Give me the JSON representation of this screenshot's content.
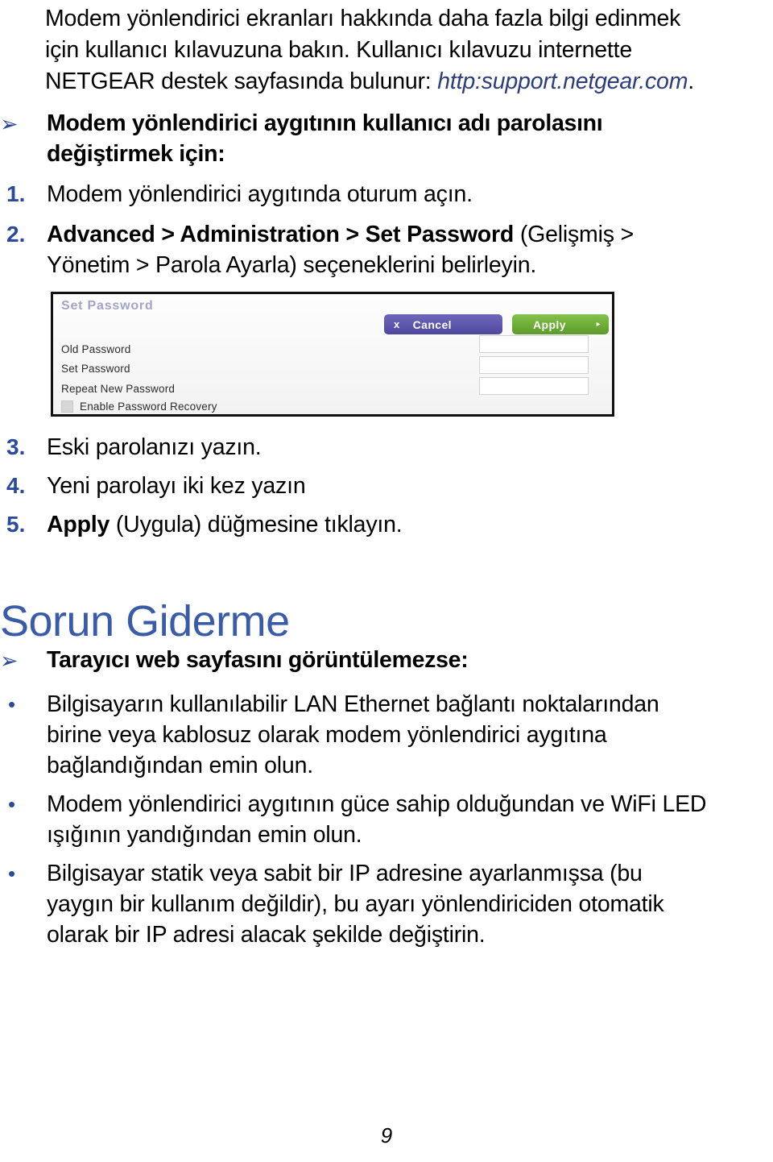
{
  "document": {
    "page_number": "9",
    "language": "tr"
  },
  "intro": {
    "line1": "Modem yönlendirici ekranları hakkında daha fazla bilgi edinmek",
    "line2": "için kullanıcı kılavuzuna bakın. Kullanıcı kılavuzu internette",
    "line3_prefix": "NETGEAR destek sayfasında bulunur: ",
    "link_text": "http:support.netgear.com",
    "line3_suffix": "."
  },
  "procedure": {
    "heading_line1": "Modem yönlendirici aygıtının kullanıcı adı parolasını",
    "heading_line2": "değiştirmek için:",
    "arrow_glyph": "➢",
    "steps": [
      {
        "number": "1.",
        "text": "Modem yönlendirici aygıtında oturum açın."
      },
      {
        "number": "2.",
        "bold_part": "Advanced > Administration > Set Password",
        "rest_line1": " (Gelişmiş >",
        "line2": "Yönetim > Parola Ayarla) seçeneklerini belirleyin."
      },
      {
        "number": "3.",
        "text": "Eski parolanızı yazın."
      },
      {
        "number": "4.",
        "text": "Yeni parolayı iki kez yazın"
      },
      {
        "number": "5.",
        "bold_part": "Apply",
        "rest": " (Uygula) düğmesine tıklayın."
      }
    ]
  },
  "screenshot": {
    "panel_title": "Set Password",
    "labels": [
      "Old Password",
      "Set Password",
      "Repeat New Password"
    ],
    "checkbox_label": "Enable Password Recovery",
    "checkbox_checked": false,
    "fields": [
      {
        "name": "old-password",
        "value": ""
      },
      {
        "name": "set-password",
        "value": ""
      },
      {
        "name": "repeat-new-password",
        "value": ""
      }
    ],
    "cancel_button": {
      "label": "Cancel",
      "icon": "x",
      "color": "#5a52a8"
    },
    "apply_button": {
      "label": "Apply",
      "icon": "▸",
      "color": "#6fae38"
    }
  },
  "troubleshooting": {
    "title": "Sorun Giderme",
    "arrow_glyph": "➢",
    "sub_heading": "Tarayıcı web sayfasını görüntülemezse:",
    "bullet_glyph": "•",
    "bullets": [
      {
        "line1": "Bilgisayarın kullanılabilir LAN Ethernet bağlantı noktalarından",
        "line2": "birine veya kablosuz olarak modem yönlendirici aygıtına",
        "line3": "bağlandığından emin olun."
      },
      {
        "line1": "Modem yönlendirici aygıtının güce sahip olduğundan ve WiFi LED",
        "line2": "ışığının yandığından emin olun.",
        "line3": ""
      },
      {
        "line1": "Bilgisayar statik veya sabit bir IP adresine ayarlanmışsa (bu",
        "line2": "yaygın bir kullanım değildir), bu ayarı yönlendiriciden otomatik",
        "line3": "olarak bir IP adresi alacak şekilde değiştirin."
      }
    ]
  },
  "colors": {
    "heading_blue": "#3a5ca8",
    "marker_blue": "#2b4a9b",
    "link_blue": "#2b3d7d",
    "panel_title": "#a3a3c9"
  }
}
